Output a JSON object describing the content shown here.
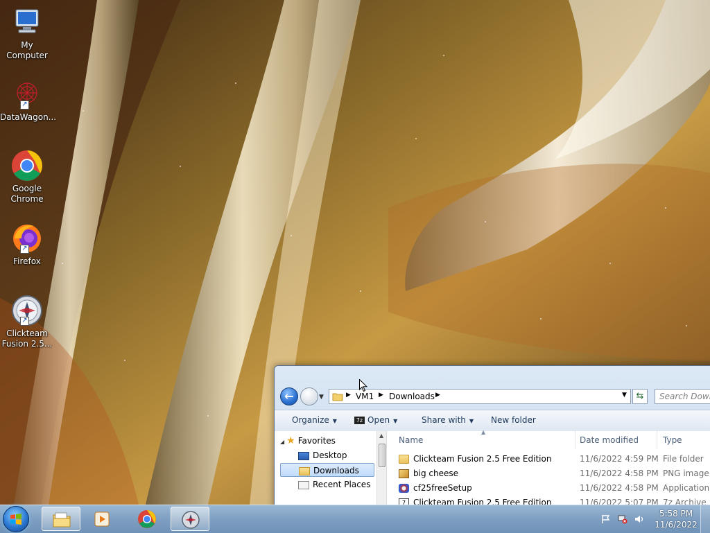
{
  "desktop": {
    "icons": [
      {
        "label": "My Computer",
        "icon": "computer-icon"
      },
      {
        "label": "DataWagon...",
        "icon": "datawagon-icon"
      },
      {
        "label": "Google Chrome",
        "icon": "chrome-icon"
      },
      {
        "label": "Firefox",
        "icon": "firefox-icon"
      },
      {
        "label": "Clickteam Fusion 2.5...",
        "icon": "clickteam-icon"
      }
    ]
  },
  "explorer": {
    "address": {
      "root": "VM1",
      "folder": "Downloads"
    },
    "search_placeholder": "Search Downloads",
    "toolbar": {
      "organize": "Organize",
      "open": "Open",
      "share_with": "Share with",
      "new_folder": "New folder"
    },
    "nav": {
      "favorites": "Favorites",
      "desktop": "Desktop",
      "downloads": "Downloads",
      "recent_places": "Recent Places"
    },
    "columns": {
      "name": "Name",
      "date_modified": "Date modified",
      "type": "Type"
    },
    "files": [
      {
        "name": "Clickteam Fusion 2.5 Free Edition",
        "date": "11/6/2022 4:59 PM",
        "type": "File folder",
        "icon": "folder-icon"
      },
      {
        "name": "big cheese",
        "date": "11/6/2022 4:58 PM",
        "type": "PNG image",
        "icon": "png-file-icon"
      },
      {
        "name": "cf25freeSetup",
        "date": "11/6/2022 4:58 PM",
        "type": "Application",
        "icon": "installer-icon"
      },
      {
        "name": "Clickteam Fusion 2.5 Free Edition",
        "date": "11/6/2022 5:07 PM",
        "type": "7z Archive",
        "icon": "7z-archive-icon"
      }
    ]
  },
  "taskbar": {
    "apps": [
      "file-explorer-icon",
      "media-player-icon",
      "chrome-icon",
      "clickteam-icon"
    ],
    "clock": {
      "time": "5:58 PM",
      "date": "11/6/2022"
    }
  },
  "colors": {
    "taskbar": "#7f9fc1",
    "selection": "#c1dcfc",
    "header_text": "#4c607a"
  }
}
